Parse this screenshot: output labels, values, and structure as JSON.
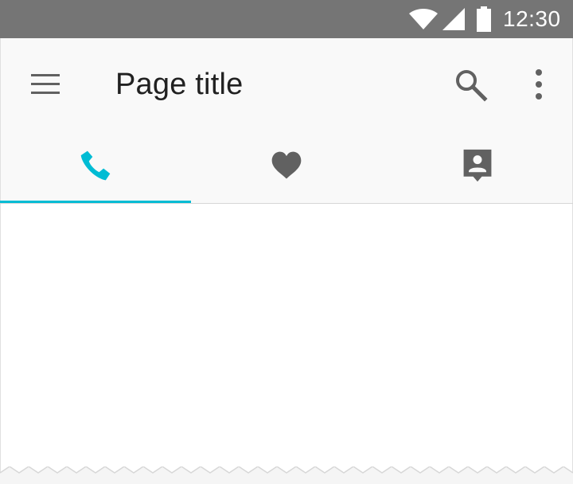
{
  "status_bar": {
    "time": "12:30",
    "icons": [
      "wifi-icon",
      "signal-icon",
      "battery-icon"
    ]
  },
  "app_bar": {
    "title": "Page title",
    "icons": {
      "navigation": "menu-icon",
      "actions": [
        "search-icon",
        "more-vert-icon"
      ]
    }
  },
  "tabs": [
    {
      "icon": "phone-icon",
      "selected": true
    },
    {
      "icon": "heart-icon",
      "selected": false
    },
    {
      "icon": "contact-card-icon",
      "selected": false
    }
  ],
  "colors": {
    "status_bar": "#757575",
    "app_bar": "#f9f9f9",
    "accent": "#00bcd4",
    "icon": "#616161",
    "title": "#212121"
  }
}
